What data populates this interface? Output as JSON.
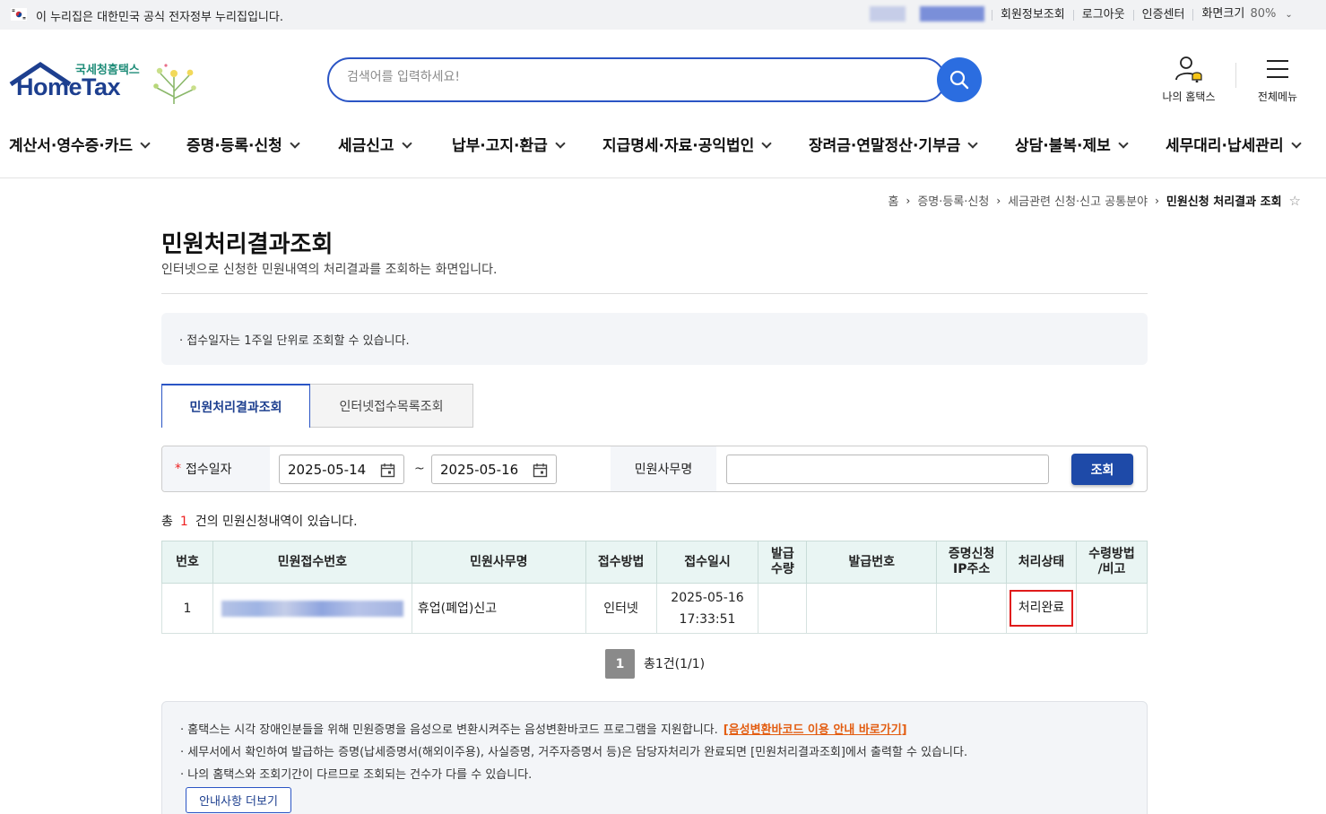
{
  "govbar": {
    "text": "이 누리집은 대한민국 공식 전자정부 누리집입니다.",
    "links": [
      "회원정보조회",
      "로그아웃",
      "인증센터",
      "화면크기"
    ],
    "zoom": "80%"
  },
  "logo": {
    "sub": "국세청홈택스",
    "main": "HomeTax"
  },
  "search": {
    "placeholder": "검색어를 입력하세요!"
  },
  "header": {
    "my_label": "나의 홈택스",
    "menu_label": "전체메뉴"
  },
  "gnb": [
    "계산서·영수증·카드",
    "증명·등록·신청",
    "세금신고",
    "납부·고지·환급",
    "지급명세·자료·공익법인",
    "장려금·연말정산·기부금",
    "상담·불복·제보",
    "세무대리·납세관리"
  ],
  "breadcrumb": [
    "홈",
    "증명·등록·신청",
    "세금관련 신청·신고 공통분야",
    "민원신청 처리결과 조회"
  ],
  "page": {
    "title": "민원처리결과조회",
    "desc": "인터넷으로 신청한 민원내역의 처리결과를 조회하는 화면입니다.",
    "info": "접수일자는 1주일 단위로 조회할 수 있습니다."
  },
  "tabs": [
    "민원처리결과조회",
    "인터넷접수목록조회"
  ],
  "form": {
    "date_label": "접수일자",
    "date_from": "2025-05-14",
    "date_to": "2025-05-16",
    "tilde": "~",
    "name_label": "민원사무명",
    "name_value": "",
    "submit": "조회"
  },
  "summary": {
    "prefix": "총",
    "count": "1",
    "suffix": "건의 민원신청내역이 있습니다."
  },
  "table": {
    "headers": [
      "번호",
      "민원접수번호",
      "민원사무명",
      "접수방법",
      "접수일시",
      "발급\n수량",
      "발급번호",
      "증명신청\nIP주소",
      "처리상태",
      "수령방법\n/비고"
    ],
    "rows": [
      {
        "no": "1",
        "receipt_no": "",
        "name": "휴업(폐업)신고",
        "method": "인터넷",
        "date": "2025-05-16",
        "time": "17:33:51",
        "qty": "",
        "issue_no": "",
        "ip": "",
        "status": "처리완료",
        "note": ""
      }
    ]
  },
  "pagination": {
    "current": "1",
    "total": "총1건(1/1)"
  },
  "notice": {
    "items": [
      "홈택스는 시각 장애인분들을 위해 민원증명을 음성으로 변환시켜주는 음성변환바코드 프로그램을 지원합니다.",
      "세무서에서 확인하여 발급하는 증명(납세증명서(해외이주용), 사실증명, 거주자증명서 등)은 담당자처리가 완료되면 [민원처리결과조회]에서 출력할 수 있습니다.",
      "나의 홈택스와 조회기간이 다르므로 조회되는 건수가 다를 수 있습니다."
    ],
    "link": "[음성변환바코드 이용 안내 바로가기]",
    "more": "안내사항 더보기"
  },
  "colors": {
    "brand": "#1d3f8f",
    "accent": "#2b6de0",
    "alert": "#e01b1b"
  }
}
